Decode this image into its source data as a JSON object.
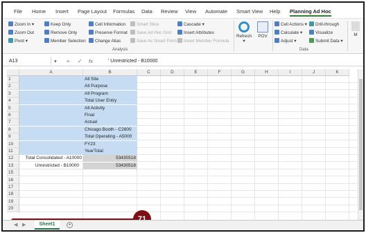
{
  "ribbon_tabs": [
    "File",
    "Home",
    "Insert",
    "Page Layout",
    "Formulas",
    "Data",
    "Review",
    "View",
    "Automate",
    "Smart View",
    "Help",
    "Planning Ad Hoc"
  ],
  "ribbon": {
    "zoom_in": "Zoom In",
    "zoom_out": "Zoom Out",
    "pivot": "Pivot",
    "keep_only": "Keep Only",
    "remove_only": "Remove Only",
    "member_selection": "Member Selection",
    "cell_information": "Cell Information",
    "preserve_format": "Preserve Format",
    "change_alias": "Change Alias",
    "smart_slice": "Smart Slice",
    "save_ad_hoc_grid": "Save Ad Hoc Grid",
    "save_as_smart_form": "Save As Smart Form",
    "cascade": "Cascade",
    "insert_attributes": "Insert Attributes",
    "insert_member_formula": "Insert Member Formula",
    "refresh": "Refresh",
    "pov": "POV",
    "cell_actions": "Cell Actions",
    "calculate": "Calculate",
    "adjust": "Adjust",
    "drill_through": "Drill-through",
    "visualize": "Visualize",
    "submit_data": "Submit Data",
    "more": "M",
    "group_analysis": "Analysis",
    "group_data": "Data"
  },
  "formula_bar": {
    "name_box": "A13",
    "cancel": "×",
    "enter": "✓",
    "fx": "fx",
    "content": "'    Unrestricted - B10000"
  },
  "columns": [
    "A",
    "B",
    "C",
    "D",
    "E",
    "F",
    "G",
    "H",
    "I",
    "J",
    "K"
  ],
  "rows": [
    {
      "n": "1",
      "a": "",
      "b": "All Site"
    },
    {
      "n": "2",
      "a": "",
      "b": "All Purpose"
    },
    {
      "n": "3",
      "a": "",
      "b": "All Program"
    },
    {
      "n": "4",
      "a": "",
      "b": "Total User Entry"
    },
    {
      "n": "5",
      "a": "",
      "b": "All Activity"
    },
    {
      "n": "6",
      "a": "",
      "b": "Final"
    },
    {
      "n": "7",
      "a": "",
      "b": "Actual"
    },
    {
      "n": "8",
      "a": "",
      "b": "Chicago Booth - C2800"
    },
    {
      "n": "9",
      "a": "",
      "b": "Total Operating - A5000"
    },
    {
      "n": "10",
      "a": "",
      "b": "FY23"
    },
    {
      "n": "11",
      "a": "",
      "b": "YearTotal"
    },
    {
      "n": "12",
      "a": "Total Consolidated - A10000",
      "b": "53430518"
    },
    {
      "n": "13",
      "a": "Unrestricted - B10000",
      "b": "53430518"
    },
    {
      "n": "15",
      "a": "",
      "b": ""
    },
    {
      "n": "16",
      "a": "",
      "b": ""
    },
    {
      "n": "17",
      "a": "",
      "b": ""
    },
    {
      "n": "18",
      "a": "",
      "b": ""
    },
    {
      "n": "19",
      "a": "",
      "b": ""
    },
    {
      "n": "20",
      "a": "",
      "b": ""
    }
  ],
  "callout_number": "71",
  "sheet_tab": "Sheet1",
  "add_sheet": "+",
  "colors": {
    "highlight": "#c6dcf3",
    "callout": "#7b1116",
    "active_tab": "#2e7d32"
  }
}
